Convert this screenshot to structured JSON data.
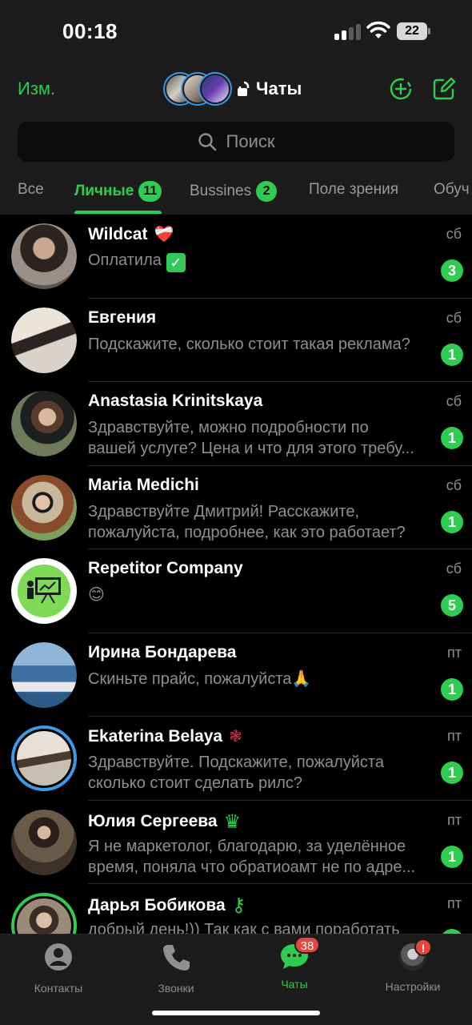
{
  "status_bar": {
    "time": "00:18",
    "battery": "22"
  },
  "header": {
    "edit_label": "Изм.",
    "title": "Чаты",
    "search_placeholder": "Поиск"
  },
  "tabs": [
    {
      "label": "Все",
      "badge": ""
    },
    {
      "label": "Личные",
      "badge": "11",
      "active": true
    },
    {
      "label": "Bussines",
      "badge": "2"
    },
    {
      "label": "Поле зрения",
      "badge": ""
    },
    {
      "label": "Обуч",
      "badge": ""
    }
  ],
  "chats": [
    {
      "name": "Wildcat",
      "name_emoji": "❤️‍🩹",
      "time": "сб",
      "message": [
        "Оплатила"
      ],
      "message_suffix": "✓",
      "unread": "3"
    },
    {
      "name": "Евгения",
      "name_emoji": "",
      "time": "сб",
      "message": [
        "Подскажите, сколько стоит такая реклама?"
      ],
      "unread": "1"
    },
    {
      "name": "Anastasia Krinitskaya",
      "name_emoji": "",
      "time": "сб",
      "message": [
        "Здравствуйте, можно подробности по",
        "вашей услуге? Цена и что для этого требу..."
      ],
      "unread": "1"
    },
    {
      "name": "Maria Medichi",
      "name_emoji": "",
      "time": "сб",
      "message": [
        "Здравствуйте Дмитрий! Расскажите,",
        "пожалуйста, подробнее, как это работает?"
      ],
      "unread": "1"
    },
    {
      "name": "Repetitor Company",
      "name_emoji": "",
      "time": "сб",
      "message": [
        "😊"
      ],
      "unread": "5"
    },
    {
      "name": "Ирина Бондарева",
      "name_emoji": "",
      "time": "пт",
      "message": [
        "Скиньте прайс, пожалуйста🙏"
      ],
      "unread": "1"
    },
    {
      "name": "Ekaterina Belaya",
      "name_emoji": "❃",
      "time": "пт",
      "message": [
        "Здравствуйте. Подскажите, пожалуйста",
        "сколько стоит сделать рилс?"
      ],
      "unread": "1"
    },
    {
      "name": "Юлия Сергеева",
      "name_emoji": "♛",
      "time": "пт",
      "message": [
        "Я не маркетолог, благодарю, за уделённое",
        "время, поняла что обратиоамт не по адре..."
      ],
      "unread": "1"
    },
    {
      "name": "Дарья Бобикова",
      "name_emoji": "⚷",
      "time": "пт",
      "message": [
        "добрый день!)) Так как с вами поработать"
      ],
      "unread": ""
    }
  ],
  "tab_bar": {
    "contacts": "Контакты",
    "calls": "Звонки",
    "chats": "Чаты",
    "chats_badge": "38",
    "settings": "Настройки",
    "settings_badge": "!"
  },
  "colors": {
    "accent": "#2ecc4f",
    "background": "#000000",
    "bar": "#1c1c1d",
    "badge_red": "#e8453c",
    "story_ring": "#3b9be8"
  },
  "icons": [
    "signal-icon",
    "wifi-icon",
    "battery-icon",
    "lock-icon",
    "new-story-icon",
    "compose-icon",
    "search-icon",
    "contacts-icon",
    "calls-icon",
    "chats-icon",
    "settings-avatar-icon"
  ]
}
